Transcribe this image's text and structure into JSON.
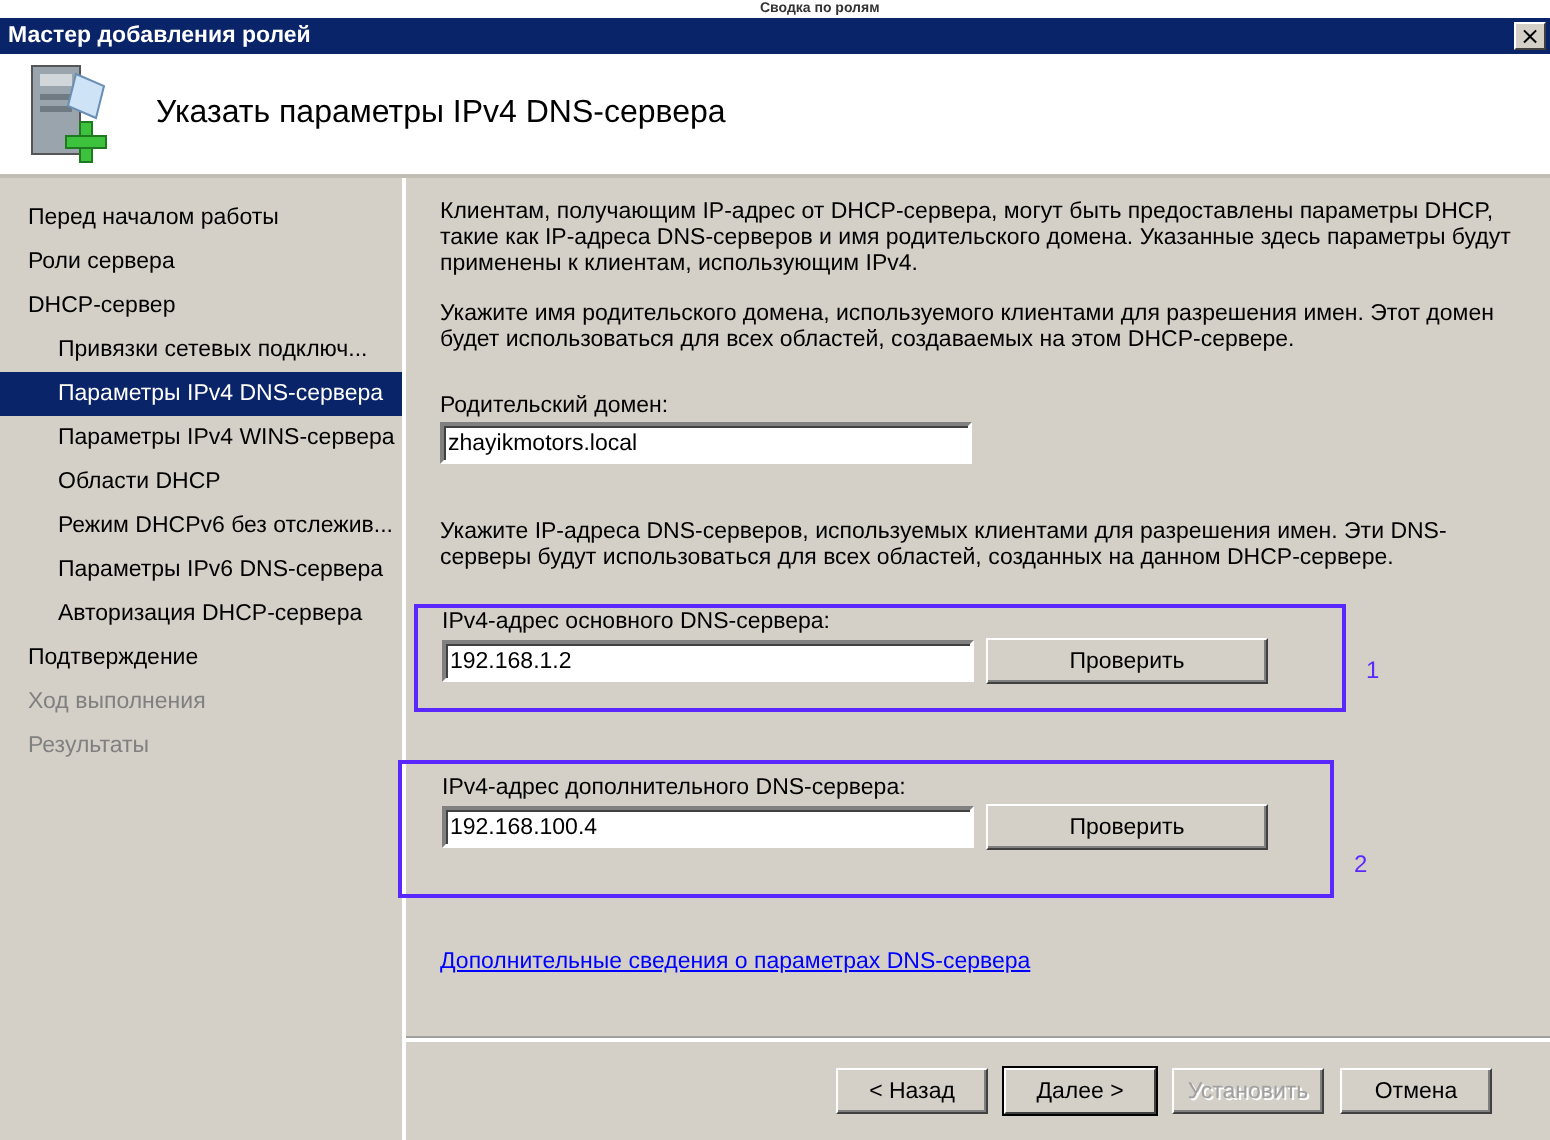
{
  "background_window": {
    "title": "Сводка по ролям"
  },
  "window": {
    "title": "Мастер добавления ролей",
    "close": "×"
  },
  "header": {
    "title": "Указать параметры IPv4 DNS-сервера"
  },
  "sidebar": {
    "items": [
      {
        "label": "Перед началом работы",
        "selected": false,
        "disabled": false
      },
      {
        "label": "Роли сервера",
        "selected": false,
        "disabled": false
      },
      {
        "label": "DHCP-сервер",
        "selected": false,
        "disabled": false,
        "children": [
          {
            "label": "Привязки сетевых подключ...",
            "selected": false,
            "disabled": false
          },
          {
            "label": "Параметры IPv4 DNS-сервера",
            "selected": true,
            "disabled": false
          },
          {
            "label": "Параметры IPv4 WINS-сервера",
            "selected": false,
            "disabled": false
          },
          {
            "label": "Области DHCP",
            "selected": false,
            "disabled": false
          },
          {
            "label": "Режим DHCPv6 без отслежив...",
            "selected": false,
            "disabled": false
          },
          {
            "label": "Параметры IPv6 DNS-сервера",
            "selected": false,
            "disabled": false
          },
          {
            "label": "Авторизация DHCP-сервера",
            "selected": false,
            "disabled": false
          }
        ]
      },
      {
        "label": "Подтверждение",
        "selected": false,
        "disabled": false
      },
      {
        "label": "Ход выполнения",
        "selected": false,
        "disabled": true
      },
      {
        "label": "Результаты",
        "selected": false,
        "disabled": true
      }
    ]
  },
  "content": {
    "intro": "Клиентам, получающим IP-адрес от DHCP-сервера, могут быть предоставлены параметры DHCP, такие как IP-адреса DNS-серверов и имя родительского домена. Указанные здесь параметры будут применены к клиентам, использующим IPv4.",
    "domain_hint": "Укажите имя родительского домена, используемого клиентами для разрешения имен. Этот домен будет использоваться для всех областей, создаваемых на этом DHCP-сервере.",
    "domain": {
      "label": "Родительский домен:",
      "value": "zhayikmotors.local"
    },
    "dns_hint": "Укажите IP-адреса DNS-серверов, используемых клиентами для разрешения имен. Эти DNS-серверы будут использоваться для всех областей, созданных на данном DHCP-сервере.",
    "dns_servers": [
      {
        "label": "IPv4-адрес основного DNS-сервера:",
        "value": "192.168.1.2",
        "button": "Проверить",
        "annotation": "1"
      },
      {
        "label": "IPv4-адрес дополнительного DNS-сервера:",
        "value": "192.168.100.4",
        "button": "Проверить",
        "annotation": "2"
      }
    ],
    "link": "Дополнительные сведения о параметрах DNS-сервера"
  },
  "buttons": [
    {
      "label": "< Назад",
      "default": false,
      "disabled": false
    },
    {
      "label": "Далее >",
      "default": true,
      "disabled": false
    },
    {
      "label": "Установить",
      "default": false,
      "disabled": true
    },
    {
      "label": "Отмена",
      "default": false,
      "disabled": false
    }
  ]
}
